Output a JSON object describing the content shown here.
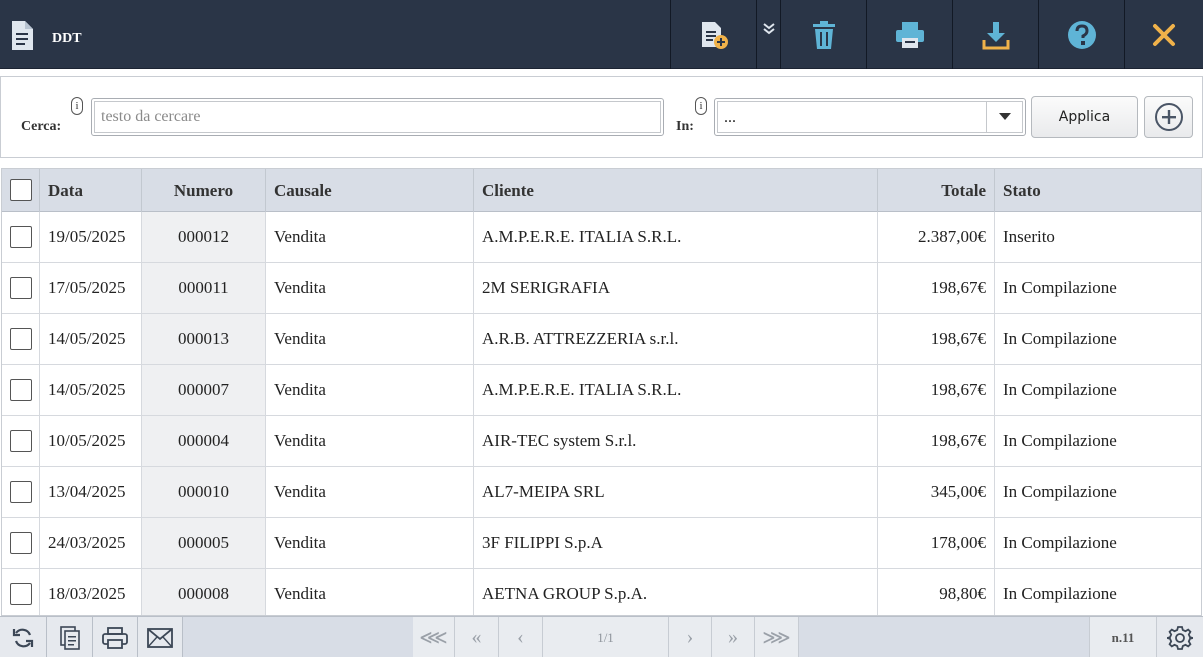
{
  "header": {
    "title": "DDT",
    "icons": [
      "document-icon",
      "new-document-icon",
      "expand-more-icon",
      "trash-icon",
      "print-icon",
      "download-icon",
      "help-icon",
      "close-icon"
    ],
    "colors": {
      "bar": "#2a3547",
      "icon": "#5fb4d6",
      "close": "#f0b24a"
    }
  },
  "search": {
    "label": "Cerca:",
    "info": "i",
    "placeholder": "testo da cercare",
    "value": "",
    "in_label": "In:",
    "in_value": "...",
    "apply_label": "Applica"
  },
  "table": {
    "columns": [
      "Data",
      "Numero",
      "Causale",
      "Cliente",
      "Totale",
      "Stato"
    ],
    "rows": [
      {
        "data": "19/05/2025",
        "numero": "000012",
        "causale": "Vendita",
        "cliente": "A.M.P.E.R.E. ITALIA S.R.L.",
        "totale": "2.387,00€",
        "stato": "Inserito"
      },
      {
        "data": "17/05/2025",
        "numero": "000011",
        "causale": "Vendita",
        "cliente": "2M SERIGRAFIA",
        "totale": "198,67€",
        "stato": "In Compilazione"
      },
      {
        "data": "14/05/2025",
        "numero": "000013",
        "causale": "Vendita",
        "cliente": "A.R.B. ATTREZZERIA s.r.l.",
        "totale": "198,67€",
        "stato": "In Compilazione"
      },
      {
        "data": "14/05/2025",
        "numero": "000007",
        "causale": "Vendita",
        "cliente": "A.M.P.E.R.E. ITALIA S.R.L.",
        "totale": "198,67€",
        "stato": "In Compilazione"
      },
      {
        "data": "10/05/2025",
        "numero": "000004",
        "causale": "Vendita",
        "cliente": "AIR-TEC system S.r.l.",
        "totale": "198,67€",
        "stato": "In Compilazione"
      },
      {
        "data": "13/04/2025",
        "numero": "000010",
        "causale": "Vendita",
        "cliente": "AL7-MEIPA SRL",
        "totale": "345,00€",
        "stato": "In Compilazione"
      },
      {
        "data": "24/03/2025",
        "numero": "000005",
        "causale": "Vendita",
        "cliente": "3F FILIPPI S.p.A",
        "totale": "178,00€",
        "stato": "In Compilazione"
      },
      {
        "data": "18/03/2025",
        "numero": "000008",
        "causale": "Vendita",
        "cliente": "AETNA GROUP S.p.A.",
        "totale": "98,80€",
        "stato": "In Compilazione"
      }
    ]
  },
  "footer": {
    "first": "⋘",
    "prev_fast": "«",
    "prev": "‹",
    "page": "1/1",
    "next": "›",
    "next_fast": "»",
    "last": "⋙",
    "count": "n.11",
    "icons": [
      "refresh-icon",
      "copy-icon",
      "print-icon",
      "mail-icon",
      "gear-icon"
    ]
  }
}
